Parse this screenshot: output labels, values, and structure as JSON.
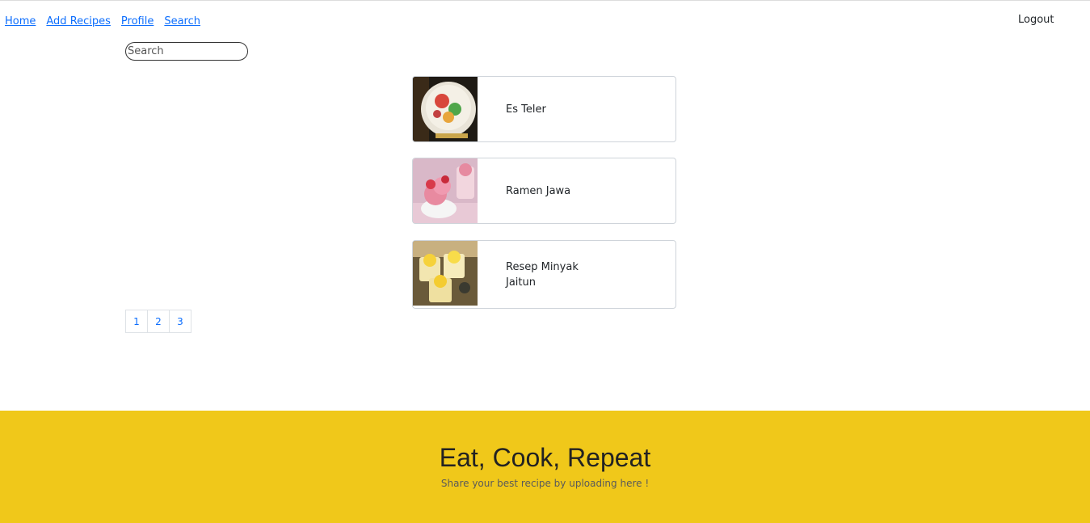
{
  "nav": {
    "links": [
      "Home",
      "Add Recipes",
      "Profile",
      "Search"
    ],
    "logout": "Logout"
  },
  "search": {
    "placeholder": "Search"
  },
  "recipes": [
    {
      "title": "Es Teler",
      "image": "es-teler-photo"
    },
    {
      "title": "Ramen Jawa",
      "image": "ice-cream-photo"
    },
    {
      "title": "Resep Minyak Jaitun",
      "image": "dessert-cups-photo"
    }
  ],
  "pagination": [
    "1",
    "2",
    "3"
  ],
  "footer": {
    "title": "Eat, Cook, Repeat",
    "subtitle": "Share your best recipe by uploading here !"
  },
  "colors": {
    "accent": "#f0c81a",
    "link": "#0d6efd"
  }
}
